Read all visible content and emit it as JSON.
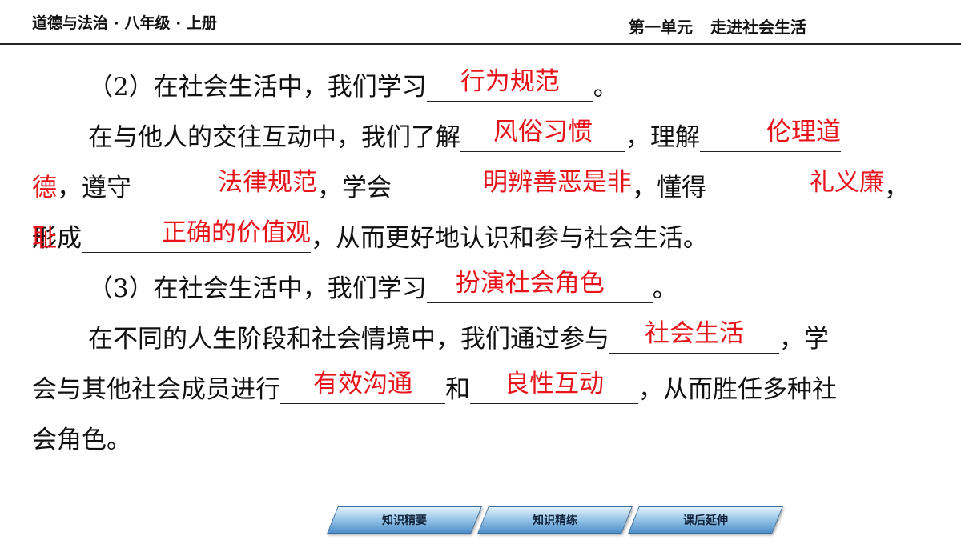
{
  "header": {
    "left_title": "道德与法治 · 八年级 · 上册",
    "unit": "第一单元",
    "unit_title": "走进社会生活"
  },
  "content": {
    "p2_head": "（2）在社会生活中，我们学习",
    "p2_ans1": "行为规范",
    "p2_tail": "。",
    "l2_a": "在与他人的交往互动中，我们了解",
    "ans_fengsu": "风俗习惯",
    "l2_b": "，理解",
    "ans_lunli_a": "伦理道",
    "ans_lunli_b": "德",
    "l3_a": "，遵守",
    "ans_falv": "法律规范",
    "l3_b": "，学会",
    "ans_mingbian": "明辨善恶是非",
    "l3_c": "，懂得",
    "ans_liyi_a": "礼义廉",
    "ans_liyi_b": "耻",
    "l3_d": "，",
    "l4_a": "形成",
    "ans_zhengque": "正确的价值观",
    "l4_b": "，从而更好地认识和参与社会生活。",
    "p3_head": "（3）在社会生活中，我们学习",
    "ans_banyan": "扮演社会角色",
    "p3_tail": "。",
    "l6_a": "在不同的人生阶段和社会情境中，我们通过参与",
    "ans_shehui": "社会生活",
    "l6_b": "，学",
    "l7_a": "会与其他社会成员进行",
    "ans_goutong": "有效沟通",
    "l7_b": "和",
    "ans_hudong": "良性互动",
    "l7_c": "，从而胜任多种社",
    "l8": "会角色。"
  },
  "nav": {
    "btn1": "知识精要",
    "btn2": "知识精练",
    "btn3": "课后延伸"
  }
}
